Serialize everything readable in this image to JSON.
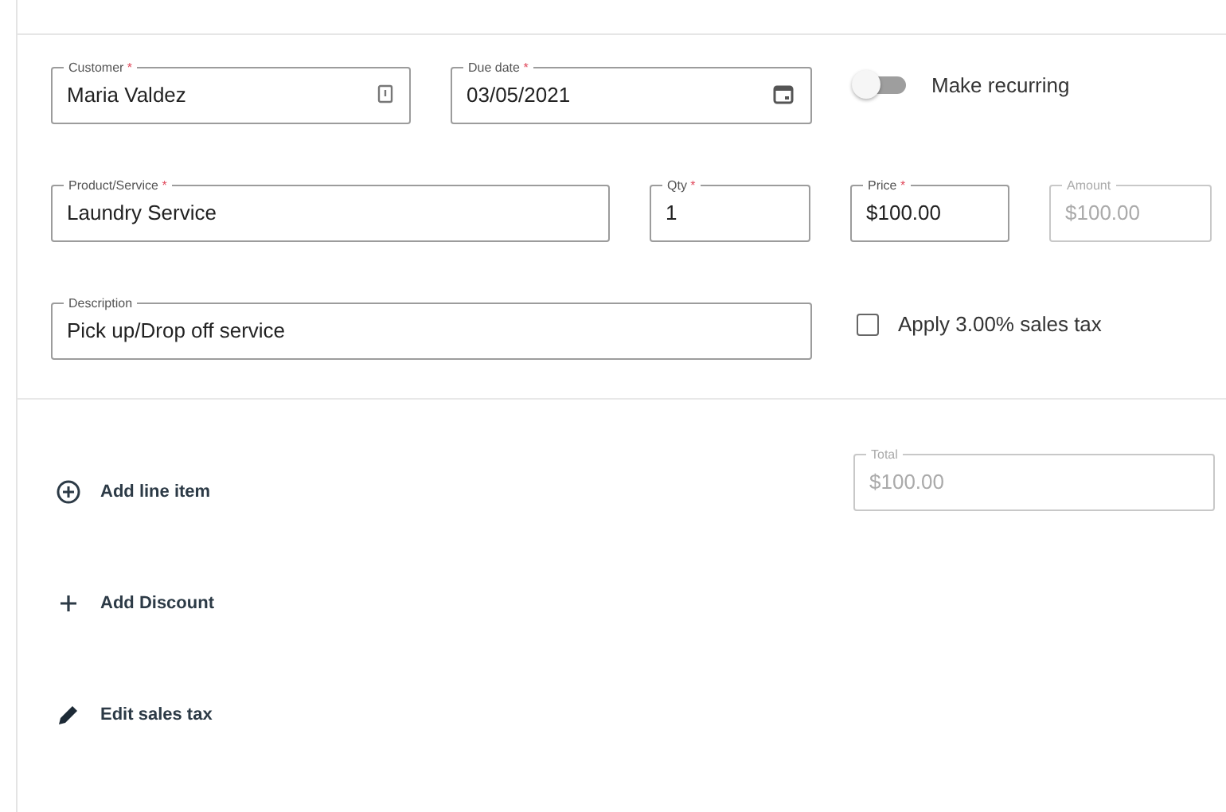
{
  "rows": [
    {
      "fields": [
        {
          "label": "Customer",
          "required": true,
          "value": "Maria Valdez",
          "disabled": false
        },
        {
          "label": "Due date",
          "required": true,
          "value": "03/05/2021",
          "disabled": false
        }
      ],
      "extra": {
        "kind": "toggle",
        "label": "Make recurring",
        "on": false
      }
    },
    {
      "fields": [
        {
          "label": "Product/Service",
          "required": true,
          "value": "Laundry Service",
          "disabled": false
        },
        {
          "label": "Qty",
          "required": true,
          "value": "1",
          "disabled": false
        },
        {
          "label": "Price",
          "required": true,
          "value": "$100.00",
          "disabled": false
        },
        {
          "label": "Amount",
          "required": false,
          "value": "$100.00",
          "disabled": true
        }
      ]
    },
    {
      "fields": [
        {
          "label": "Description",
          "required": false,
          "value": "Pick up/Drop off service",
          "disabled": false
        }
      ],
      "extra": {
        "kind": "checkbox",
        "label": "Apply 3.00% sales tax",
        "checked": false
      }
    }
  ],
  "required_mark": "*",
  "actions": [
    {
      "label": "Add line item"
    },
    {
      "label": "Add Discount"
    },
    {
      "label": "Edit sales tax"
    }
  ],
  "total": {
    "label": "Total",
    "value": "$100.00",
    "disabled": true
  }
}
